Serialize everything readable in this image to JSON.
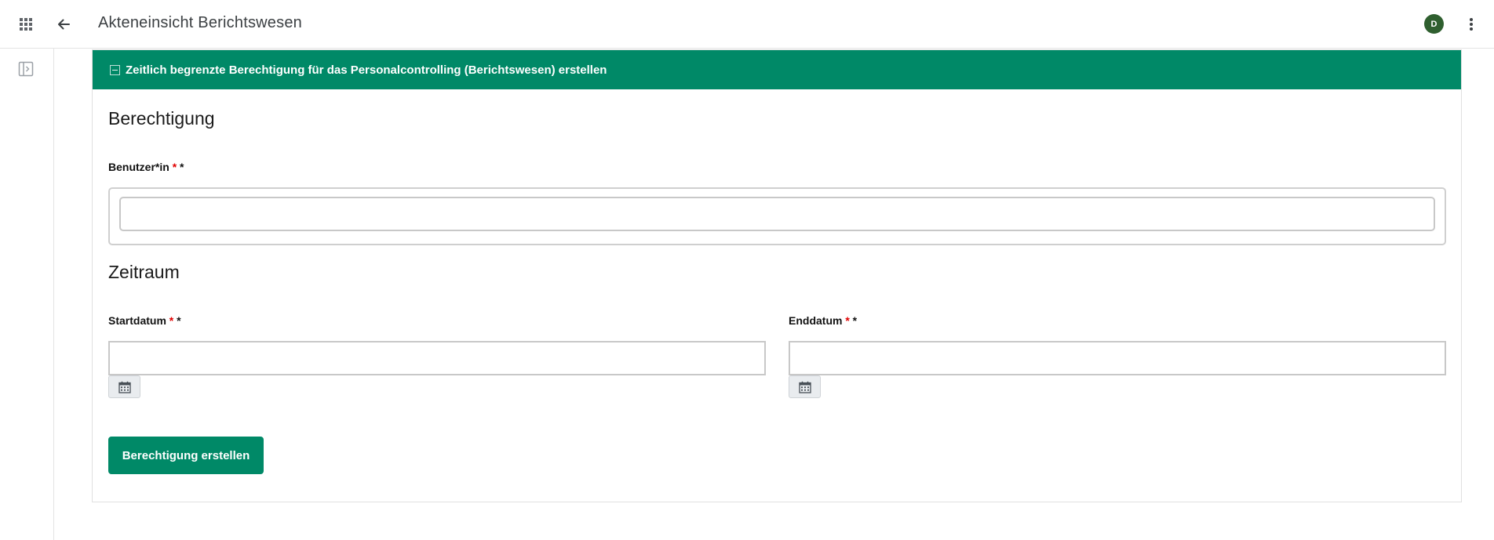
{
  "app": {
    "title": "Akteneinsicht Berichtswesen",
    "user_initial": "D",
    "icons": {
      "apps": "apps-grid-icon",
      "back": "arrow-back-icon",
      "more": "more-vert-icon",
      "panel": "side-panel-icon"
    }
  },
  "card": {
    "header": "Zeitlich begrenzte Berechtigung für das Personalcontrolling (Berichtswesen) erstellen",
    "section_permission": "Berechtigung",
    "user_label": "Benutzer*in",
    "user_value": "",
    "section_period": "Zeitraum",
    "start_label": "Startdatum",
    "start_value": "",
    "end_label": "Enddatum",
    "end_value": "",
    "required_marker": "*",
    "required_suffix": " *",
    "submit_label": "Berechtigung erstellen"
  },
  "colors": {
    "accent": "#008967",
    "avatar": "#2f5f2f",
    "required": "#e00000"
  }
}
